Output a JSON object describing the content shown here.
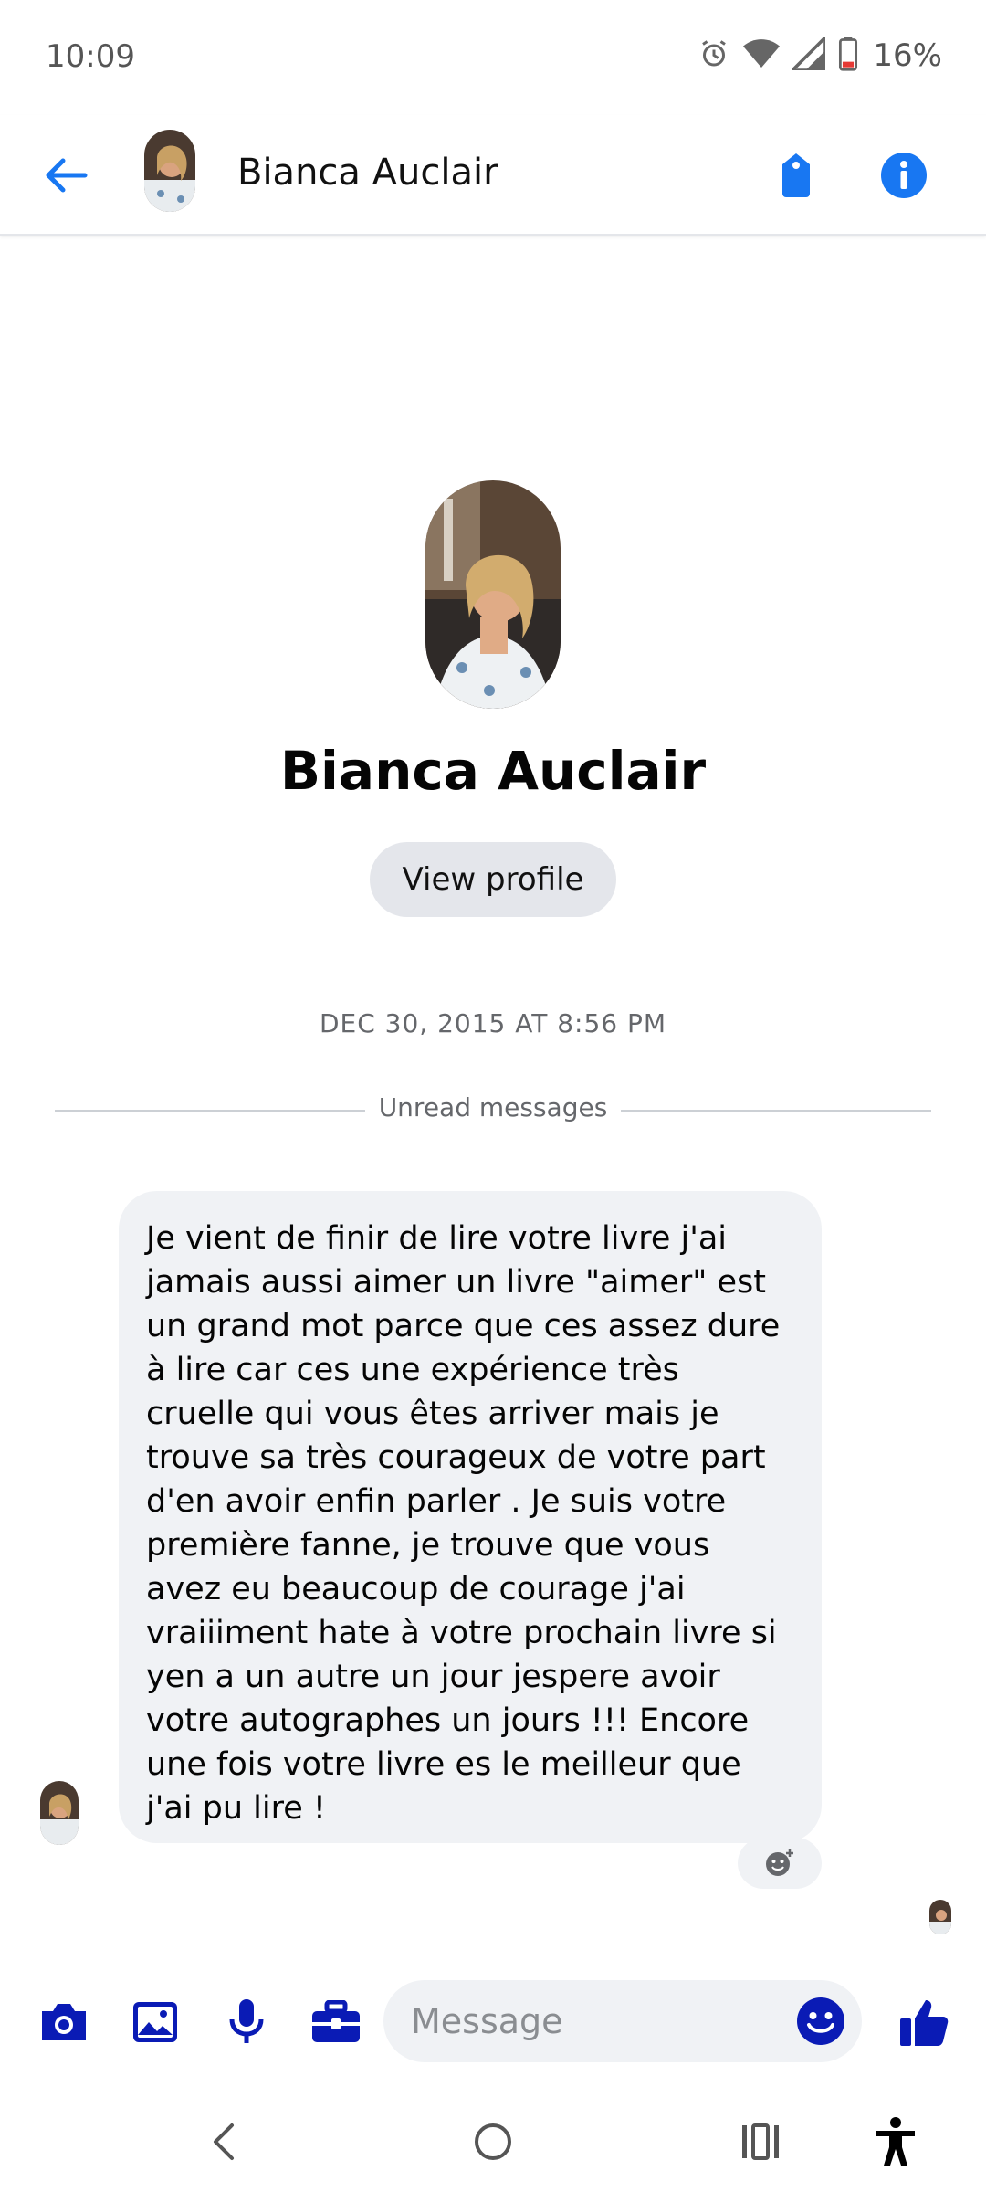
{
  "status_bar": {
    "time": "10:09",
    "battery": "16%",
    "icons": [
      "alarm-icon",
      "wifi-icon",
      "signal-icon",
      "battery-icon"
    ]
  },
  "header": {
    "name": "Bianca Auclair",
    "icons": [
      "back-arrow-icon",
      "tag-icon",
      "info-icon"
    ],
    "accent_color": "#1877f2"
  },
  "profile": {
    "name": "Bianca Auclair",
    "view_profile_label": "View profile"
  },
  "conversation": {
    "timestamp": "DEC 30, 2015 AT 8:56 PM",
    "unread_label": "Unread messages",
    "messages": [
      {
        "sender": "Bianca Auclair",
        "text": "Je vient de finir de lire votre livre j'ai jamais aussi aimer un livre \"aimer\" est un grand mot parce que ces assez dure à lire car ces une expérience très cruelle qui vous êtes arriver mais je trouve sa très courageux de votre part d'en avoir enfin parler . Je suis votre première fanne,  je trouve que vous avez eu beaucoup de courage j'ai vraiiiment hate à votre prochain livre si yen a un autre un jour jespere avoir votre autographes un jours !!! Encore une fois votre livre es le meilleur que j'ai pu lire !"
      }
    ]
  },
  "composer": {
    "placeholder": "Message",
    "icons": [
      "camera-icon",
      "gallery-icon",
      "microphone-icon",
      "briefcase-icon",
      "emoji-icon",
      "thumbs-up-icon"
    ],
    "icon_color": "#0a1bb5"
  },
  "nav_bar": {
    "icons": [
      "back-nav-icon",
      "home-nav-icon",
      "recents-nav-icon",
      "accessibility-icon"
    ]
  }
}
